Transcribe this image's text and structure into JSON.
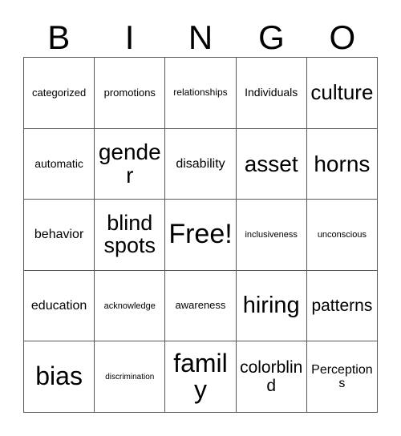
{
  "card": {
    "title": "BINGO",
    "header_letters": [
      "B",
      "I",
      "N",
      "G",
      "O"
    ],
    "columns": 5,
    "rows": 5,
    "border_color": "#58595b",
    "background_color": "#ffffff",
    "text_color": "#000000",
    "free_space": "Free!",
    "cells": [
      [
        {
          "label": "categorized",
          "size": "fs-m"
        },
        {
          "label": "promotions",
          "size": "fs-m"
        },
        {
          "label": "relationships",
          "size": "fs-sm"
        },
        {
          "label": "Individuals",
          "size": "fs-ml"
        },
        {
          "label": "culture",
          "size": "fs-2xl"
        }
      ],
      [
        {
          "label": "automatic",
          "size": "fs-ml"
        },
        {
          "label": "gender",
          "size": "fs-4xl"
        },
        {
          "label": "disability",
          "size": "fs-l"
        },
        {
          "label": "asset",
          "size": "fs-4xl"
        },
        {
          "label": "horns",
          "size": "fs-4xl"
        }
      ],
      [
        {
          "label": "behavior",
          "size": "fs-l"
        },
        {
          "label": "blind spots",
          "size": "fs-3xl"
        },
        {
          "label": "Free!",
          "size": "fs-free"
        },
        {
          "label": "inclusiveness",
          "size": "fs-s"
        },
        {
          "label": "unconscious",
          "size": "fs-s"
        }
      ],
      [
        {
          "label": "education",
          "size": "fs-l"
        },
        {
          "label": "acknowledge",
          "size": "fs-s"
        },
        {
          "label": "awareness",
          "size": "fs-m"
        },
        {
          "label": "hiring",
          "size": "fs-5xl"
        },
        {
          "label": "patterns",
          "size": "fs-xl"
        }
      ],
      [
        {
          "label": "bias",
          "size": "fs-6xl"
        },
        {
          "label": "discrimination",
          "size": "fs-xs"
        },
        {
          "label": "family",
          "size": "fs-6xl"
        },
        {
          "label": "colorblind",
          "size": "fs-xl"
        },
        {
          "label": "Perceptions",
          "size": "fs-l"
        }
      ]
    ]
  }
}
